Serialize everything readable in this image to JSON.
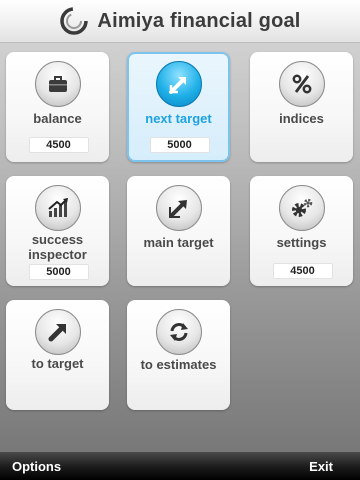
{
  "header": {
    "title": "Aimiya financial goal",
    "logo_icon": "swirl-logo-icon"
  },
  "tiles": [
    {
      "label": "balance",
      "icon": "briefcase-icon",
      "value": "4500"
    },
    {
      "label": "next target",
      "icon": "arrow-expand-icon",
      "value": "5000",
      "selected": true
    },
    {
      "label": "indices",
      "icon": "percent-icon"
    },
    {
      "label": "success inspector",
      "icon": "growth-chart-icon",
      "value": "5000"
    },
    {
      "label": "main target",
      "icon": "arrow-edit-icon"
    },
    {
      "label": "settings",
      "icon": "gears-icon",
      "value": "4500"
    },
    {
      "label": "to target",
      "icon": "arrow-up-right-icon"
    },
    {
      "label": "to estimates",
      "icon": "refresh-icon"
    }
  ],
  "softkeys": {
    "left": "Options",
    "right": "Exit"
  },
  "colors": {
    "selected_accent": "#1ea3e0",
    "selected_border": "#7cc3ee"
  }
}
